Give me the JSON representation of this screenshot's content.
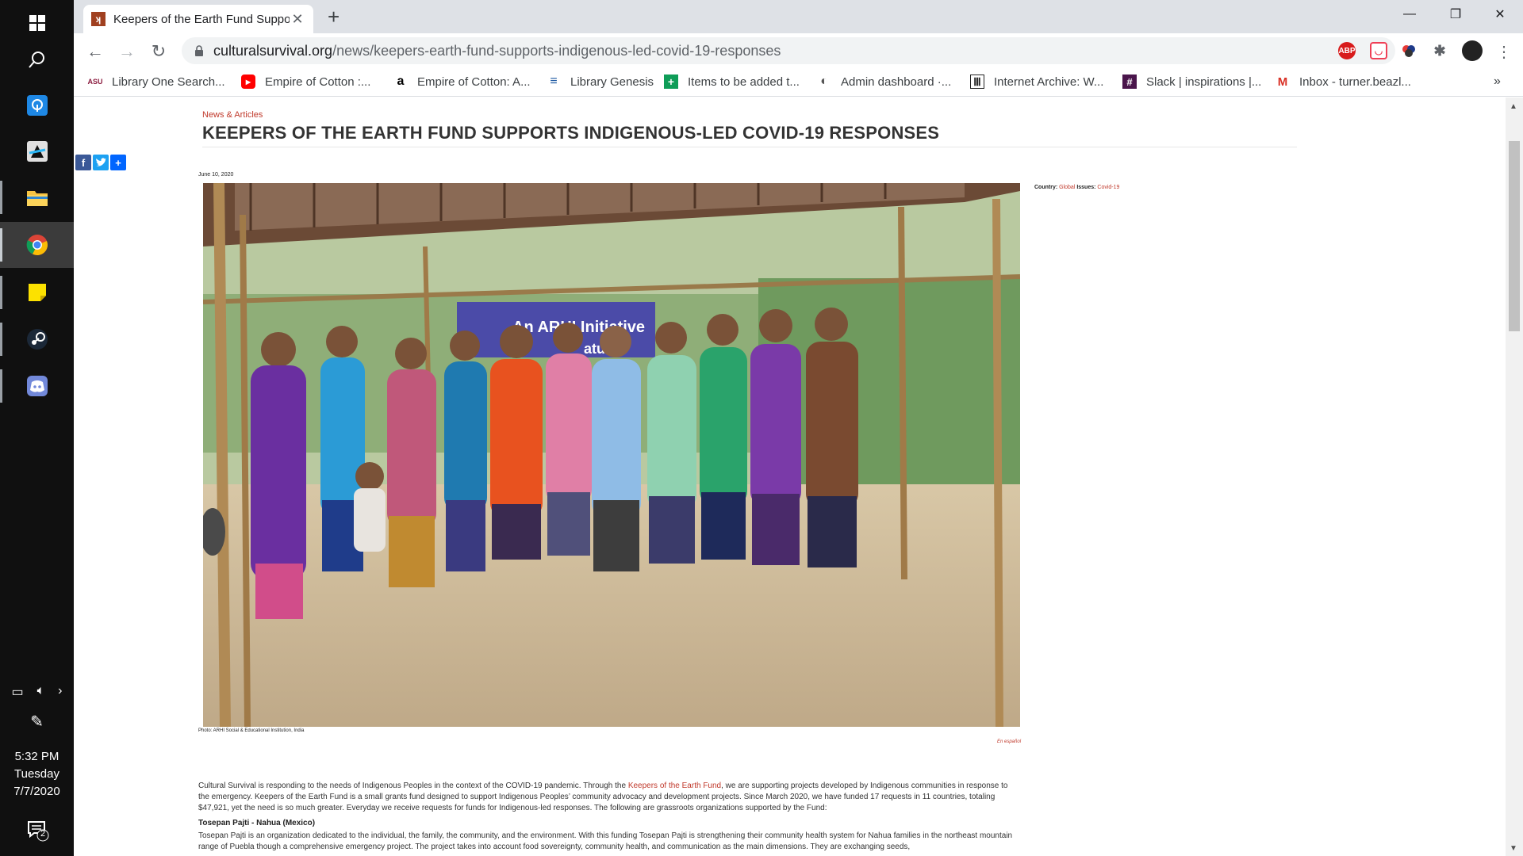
{
  "taskbar": {
    "apps": [
      {
        "name": "windows-start-icon"
      },
      {
        "name": "search-icon"
      },
      {
        "name": "remote-desktop-icon"
      },
      {
        "name": "app-icon"
      },
      {
        "name": "file-explorer-icon"
      },
      {
        "name": "chrome-icon"
      },
      {
        "name": "sticky-notes-icon"
      },
      {
        "name": "steam-icon"
      },
      {
        "name": "discord-icon"
      }
    ],
    "clock": {
      "time": "5:32 PM",
      "day": "Tuesday",
      "date": "7/7/2020"
    },
    "notifications_count": "2"
  },
  "browser": {
    "tab": {
      "title": "Keepers of the Earth Fund Suppo"
    },
    "url": {
      "host": "culturalsurvival.org",
      "path": "/news/keepers-earth-fund-supports-indigenous-led-covid-19-responses"
    },
    "extensions": [
      {
        "name": "adblock-plus-icon",
        "label": "ABP",
        "color": "#d81b1b"
      },
      {
        "name": "pocket-icon",
        "label": "",
        "color": "#ef4056"
      },
      {
        "name": "extension-icon",
        "label": "",
        "color": "#444444"
      },
      {
        "name": "puzzle-icon",
        "label": "",
        "color": "#5f6368"
      }
    ],
    "bookmarks": [
      {
        "label": "Library One Search...",
        "icon": "ASU",
        "color": "#8c1d40"
      },
      {
        "label": "Empire of Cotton :...",
        "icon": "▶",
        "color": "#ff0000"
      },
      {
        "label": "Empire of Cotton: A...",
        "icon": "a",
        "color": "#000000"
      },
      {
        "label": "Library Genesis",
        "icon": "≡",
        "color": "#1a56a0"
      },
      {
        "label": "Items to be added t...",
        "icon": "+",
        "color": "#0f9d58"
      },
      {
        "label": "Admin dashboard ·...",
        "icon": "◐",
        "color": "#555555"
      },
      {
        "label": "Internet Archive: W...",
        "icon": "Ⅲ",
        "color": "#222222"
      },
      {
        "label": "Slack | inspirations |...",
        "icon": "#",
        "color": "#4a154b"
      },
      {
        "label": "Inbox - turner.beazl...",
        "icon": "M",
        "color": "#d93025"
      }
    ]
  },
  "article": {
    "kicker": "News & Articles",
    "headline": "KEEPERS OF THE EARTH FUND SUPPORTS INDIGENOUS-LED COVID-19 RESPONSES",
    "date": "June 10, 2020",
    "meta": {
      "country_label": "Country:",
      "country": "Global",
      "issues_label": "Issues:",
      "issues": "Covid-19"
    },
    "banner_text": "An ARHI Initiative",
    "banner_text2": "atur",
    "photo_caption": "Photo: ARHI Social & Educational Institution, India",
    "espanol": "En español",
    "para1_a": "Cultural Survival is responding to the needs of Indigenous Peoples in the context of the COVID-19 pandemic. Through the ",
    "para1_link": "Keepers of the Earth Fund",
    "para1_b": ", we are supporting projects developed by Indigenous communities in response to the emergency. Keepers of the Earth Fund is a small grants fund designed to support Indigenous Peoples’ community advocacy and development projects. Since March 2020, we have funded 17 requests in 11 countries, totaling $47,921, yet the need is so much greater. Everyday we receive requests for funds for Indigenous-led responses. The following are grassroots organizations supported by the Fund:",
    "org1_title": "Tosepan Pajti - Nahua (Mexico)",
    "org1_text": "Tosepan Pajti is an organization dedicated to the individual, the family, the community, and the environment. With this funding Tosepan Pajti is strengthening their community health system for Nahua families in the northeast mountain range of Puebla though a comprehensive emergency project. The project takes into account food sovereignty, community health, and communication as the main dimensions. They are exchanging seeds,"
  }
}
